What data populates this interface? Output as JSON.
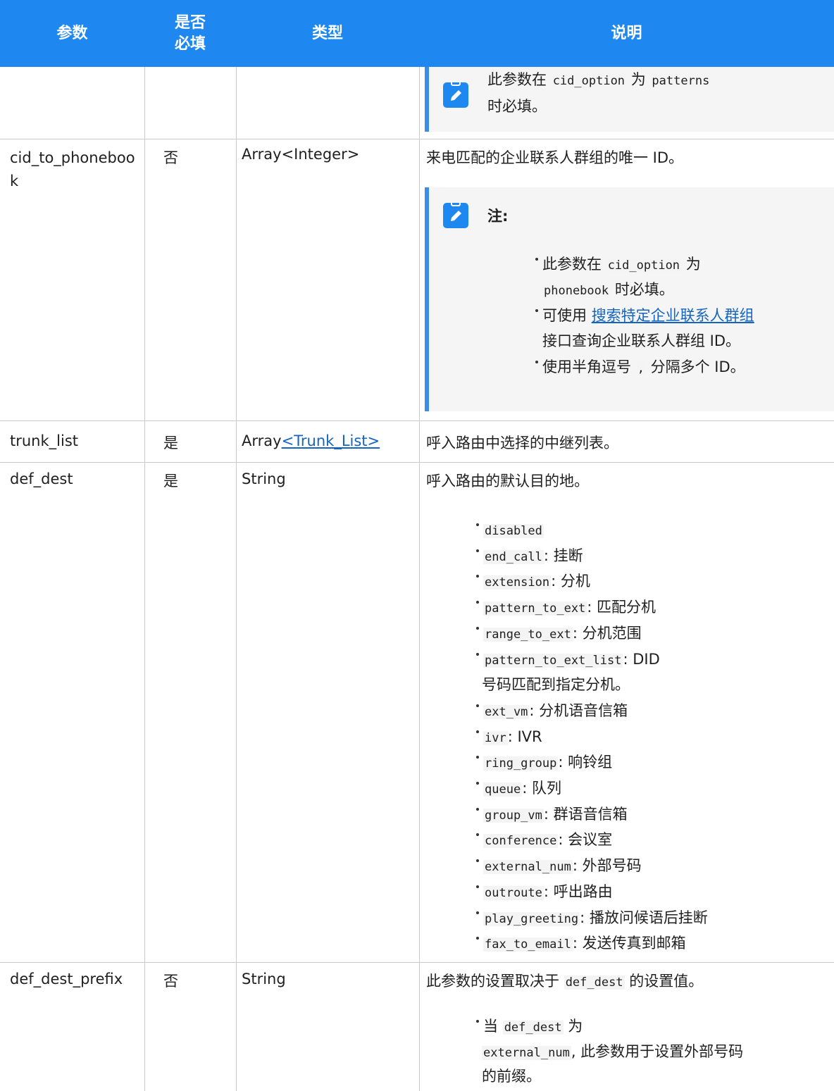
{
  "header": {
    "param": "参数",
    "required_line1": "是否",
    "required_line2": "必填",
    "type": "类型",
    "desc": "说明"
  },
  "row0": {
    "note_text_prefix": "此参数在",
    "note_code1": "cid_option",
    "note_text_mid": "为",
    "note_code2": "patterns",
    "note_text_end": "时必填。"
  },
  "row1": {
    "param_line1": "cid_to_phoneboo",
    "param_line2": "k",
    "required": "否",
    "type": "Array<Integer>",
    "desc": "来电匹配的企业联系人群组的唯一 ID。",
    "note_title": "注:",
    "b1_prefix": "此参数在",
    "b1_code1": "cid_option",
    "b1_mid": "为",
    "b1_code2": "phonebook",
    "b1_end": "时必填。",
    "b2_prefix": "可使用",
    "b2_link": "搜索特定企业联系人群组",
    "b2_end": "接口查询企业联系人群组 ID。",
    "b3_prefix": "使用半角逗号",
    "b3_code": ",",
    "b3_end": "分隔多个 ID。"
  },
  "row2": {
    "param": "trunk_list",
    "required": "是",
    "type_prefix": "Array",
    "type_link": "<Trunk_List>",
    "desc": "呼入路由中选择的中继列表。"
  },
  "row3": {
    "param": "def_dest",
    "required": "是",
    "type": "String",
    "desc": "呼入路由的默认目的地。",
    "items": [
      {
        "code": "disabled",
        "text": ""
      },
      {
        "code": "end_call",
        "text": ": 挂断"
      },
      {
        "code": "extension",
        "text": ": 分机"
      },
      {
        "code": "pattern_to_ext",
        "text": ": 匹配分机"
      },
      {
        "code": "range_to_ext",
        "text": ": 分机范围"
      },
      {
        "code": "pattern_to_ext_list",
        "text": ": DID"
      },
      {
        "code": "",
        "text": "号码匹配到指定分机。"
      },
      {
        "code": "ext_vm",
        "text": ": 分机语音信箱"
      },
      {
        "code": "ivr",
        "text": ": IVR"
      },
      {
        "code": "ring_group",
        "text": ": 响铃组"
      },
      {
        "code": "queue",
        "text": ": 队列"
      },
      {
        "code": "group_vm",
        "text": ": 群语音信箱"
      },
      {
        "code": "conference",
        "text": ": 会议室"
      },
      {
        "code": "external_num",
        "text": ": 外部号码"
      },
      {
        "code": "outroute",
        "text": ": 呼出路由"
      },
      {
        "code": "play_greeting",
        "text": ": 播放问候语后挂断"
      },
      {
        "code": "fax_to_email",
        "text": ": 发送传真到邮箱"
      }
    ]
  },
  "row4": {
    "param": "def_dest_prefix",
    "required": "否",
    "type": "String",
    "desc_prefix": "此参数的设置取决于",
    "desc_code": "def_dest",
    "desc_end": "的设置值。",
    "b1_prefix": "当",
    "b1_code": "def_dest",
    "b1_mid": "为",
    "b1_code2": "external_num",
    "b1_end": ", 此参数用于设置外部号码",
    "b1_line3": "的前缀。"
  }
}
